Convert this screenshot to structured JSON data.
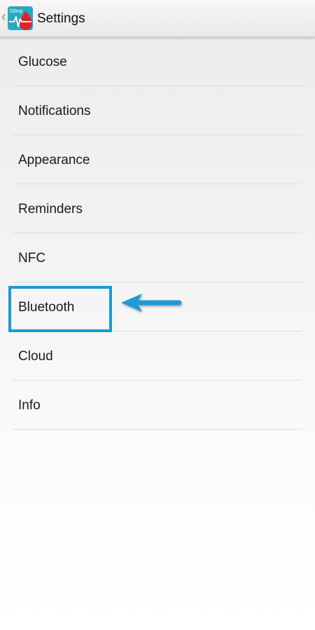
{
  "app_bar": {
    "title": "Settings",
    "app_icon_label": "Glimp",
    "back_icon": "chevron-left-icon"
  },
  "settings": {
    "items": [
      {
        "label": "Glucose"
      },
      {
        "label": "Notifications"
      },
      {
        "label": "Appearance"
      },
      {
        "label": "Reminders"
      },
      {
        "label": "NFC"
      },
      {
        "label": "Bluetooth"
      },
      {
        "label": "Cloud"
      },
      {
        "label": "Info"
      }
    ]
  },
  "annotation": {
    "highlighted_item": "Bluetooth",
    "color": "#1a9ad6"
  },
  "colors": {
    "icon_teal": "#29a9c1",
    "icon_red": "#d8262f",
    "divider": "#dcdcdc"
  }
}
